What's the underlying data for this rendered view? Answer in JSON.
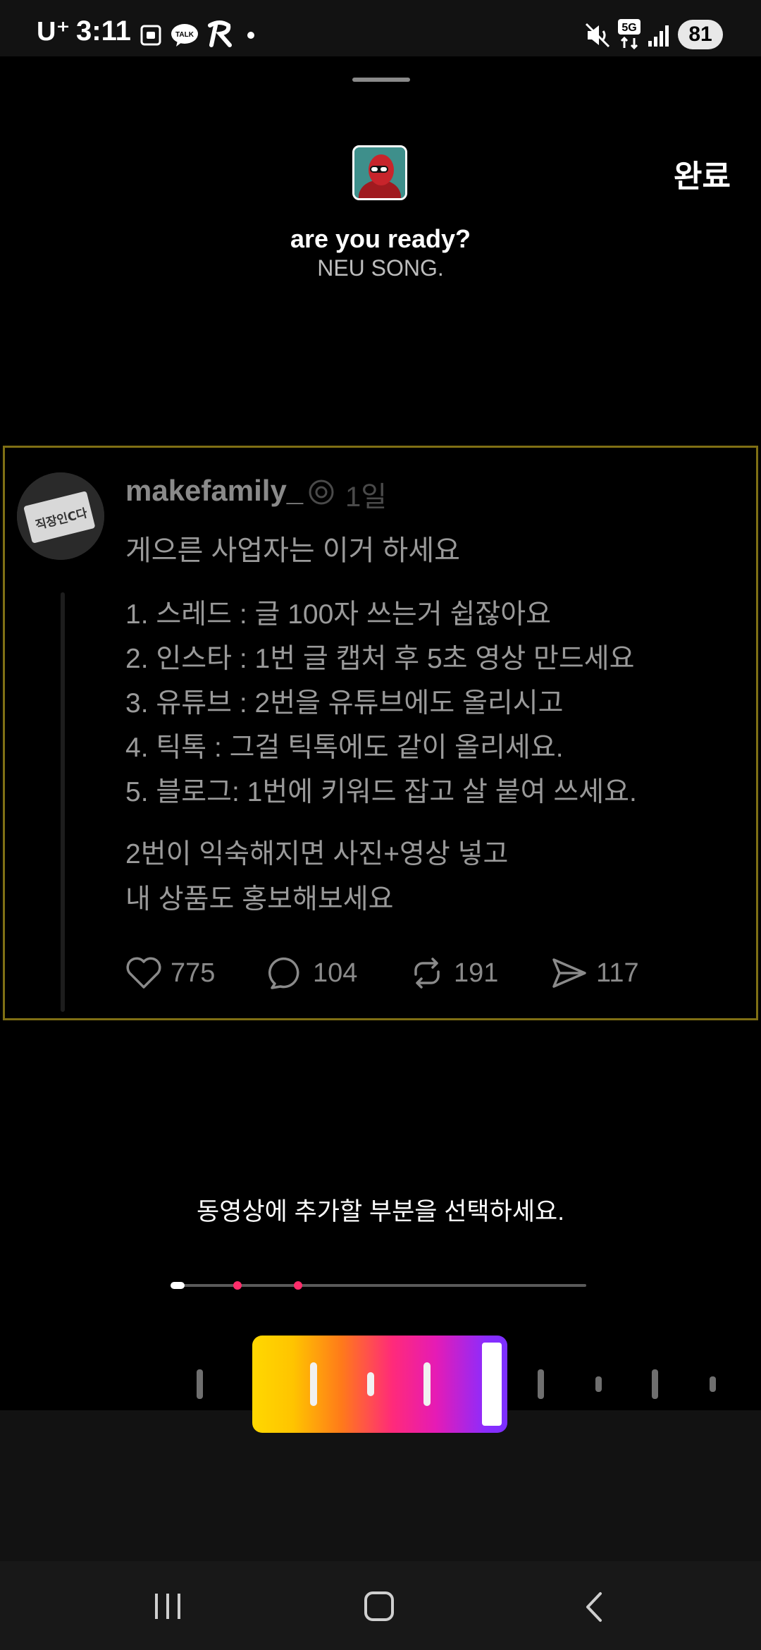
{
  "status_bar": {
    "carrier": "U⁺",
    "time": "3:11",
    "battery": "81",
    "icons": [
      "screenshot-icon",
      "kakaotalk-icon",
      "app-r-icon",
      "dot-icon",
      "mute-icon",
      "5g-icon",
      "signal-icon"
    ]
  },
  "header": {
    "done_label": "완료"
  },
  "song": {
    "title": "are you ready?",
    "artist": "NEU SONG."
  },
  "post": {
    "username": "makefamily_",
    "time": "1일",
    "avatar_text": "직장인C다",
    "headline": "게으른 사업자는 이거 하세요",
    "list": [
      "1. 스레드 : 글 100자 쓰는거 쉽잖아요",
      "2. 인스타 : 1번 글 캡처 후 5초 영상 만드세요",
      "3. 유튜브 : 2번을 유튜브에도 올리시고",
      "4. 틱톡 : 그걸 틱톡에도 같이 올리세요.",
      "5. 블로그: 1번에 키워드 잡고 살 붙여 쓰세요."
    ],
    "paragraph": [
      "2번이 익숙해지면 사진+영상 넣고",
      "내 상품도 홍보해보세요"
    ],
    "actions": {
      "likes": "775",
      "comments": "104",
      "reposts": "191",
      "shares": "117"
    }
  },
  "editor": {
    "instruction": "동영상에 추가할 부분을 선택하세요.",
    "accent_color": "#ff2d6b"
  }
}
